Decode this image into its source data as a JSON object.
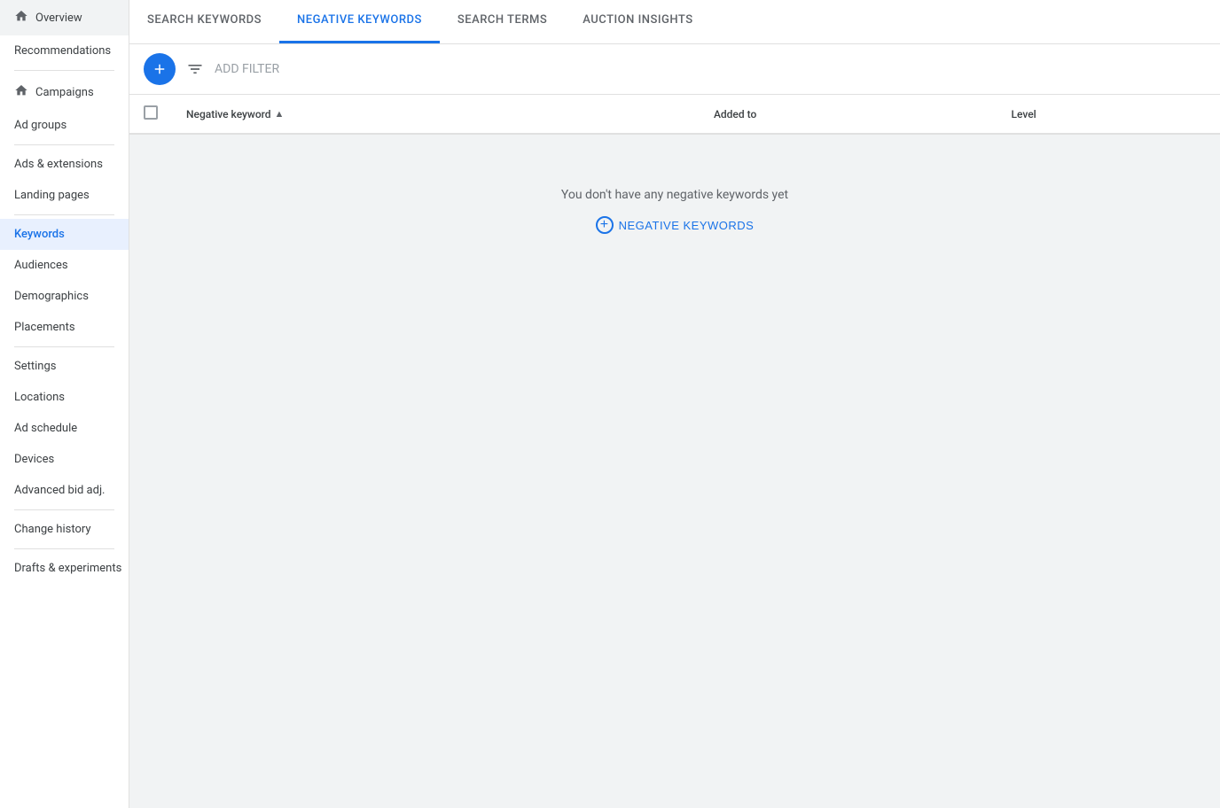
{
  "sidebar": {
    "items": [
      {
        "label": "Overview",
        "name": "overview",
        "hasIcon": true,
        "active": false,
        "dividerAfter": false
      },
      {
        "label": "Recommendations",
        "name": "recommendations",
        "hasIcon": false,
        "active": false,
        "dividerAfter": true
      },
      {
        "label": "Campaigns",
        "name": "campaigns",
        "hasIcon": true,
        "active": false,
        "dividerAfter": false
      },
      {
        "label": "Ad groups",
        "name": "ad-groups",
        "hasIcon": false,
        "active": false,
        "dividerAfter": true
      },
      {
        "label": "Ads & extensions",
        "name": "ads-extensions",
        "hasIcon": false,
        "active": false,
        "dividerAfter": false
      },
      {
        "label": "Landing pages",
        "name": "landing-pages",
        "hasIcon": false,
        "active": false,
        "dividerAfter": true
      },
      {
        "label": "Keywords",
        "name": "keywords",
        "hasIcon": false,
        "active": true,
        "dividerAfter": false
      },
      {
        "label": "Audiences",
        "name": "audiences",
        "hasIcon": false,
        "active": false,
        "dividerAfter": false
      },
      {
        "label": "Demographics",
        "name": "demographics",
        "hasIcon": false,
        "active": false,
        "dividerAfter": false
      },
      {
        "label": "Placements",
        "name": "placements",
        "hasIcon": false,
        "active": false,
        "dividerAfter": true
      },
      {
        "label": "Settings",
        "name": "settings",
        "hasIcon": false,
        "active": false,
        "dividerAfter": false
      },
      {
        "label": "Locations",
        "name": "locations",
        "hasIcon": false,
        "active": false,
        "dividerAfter": false
      },
      {
        "label": "Ad schedule",
        "name": "ad-schedule",
        "hasIcon": false,
        "active": false,
        "dividerAfter": false
      },
      {
        "label": "Devices",
        "name": "devices",
        "hasIcon": false,
        "active": false,
        "dividerAfter": false
      },
      {
        "label": "Advanced bid adj.",
        "name": "advanced-bid-adj",
        "hasIcon": false,
        "active": false,
        "dividerAfter": true
      },
      {
        "label": "Change history",
        "name": "change-history",
        "hasIcon": false,
        "active": false,
        "dividerAfter": true
      },
      {
        "label": "Drafts & experiments",
        "name": "drafts-experiments",
        "hasIcon": false,
        "active": false,
        "dividerAfter": false
      }
    ]
  },
  "tabs": [
    {
      "label": "SEARCH KEYWORDS",
      "name": "search-keywords",
      "active": false
    },
    {
      "label": "NEGATIVE KEYWORDS",
      "name": "negative-keywords",
      "active": true
    },
    {
      "label": "SEARCH TERMS",
      "name": "search-terms",
      "active": false
    },
    {
      "label": "AUCTION INSIGHTS",
      "name": "auction-insights",
      "active": false
    }
  ],
  "toolbar": {
    "add_button_label": "+",
    "filter_label": "ADD FILTER"
  },
  "table": {
    "columns": [
      {
        "label": "",
        "name": "checkbox-col"
      },
      {
        "label": "Negative keyword",
        "name": "negative-keyword-col",
        "sortable": true
      },
      {
        "label": "Added to",
        "name": "added-to-col"
      },
      {
        "label": "Level",
        "name": "level-col"
      }
    ]
  },
  "empty_state": {
    "message": "You don't have any negative keywords yet",
    "button_label": "NEGATIVE KEYWORDS"
  },
  "colors": {
    "accent": "#1a73e8",
    "active_bg": "#e8f0fe",
    "divider": "#e0e0e0",
    "text_secondary": "#5f6368",
    "text_hint": "#9aa0a6"
  }
}
